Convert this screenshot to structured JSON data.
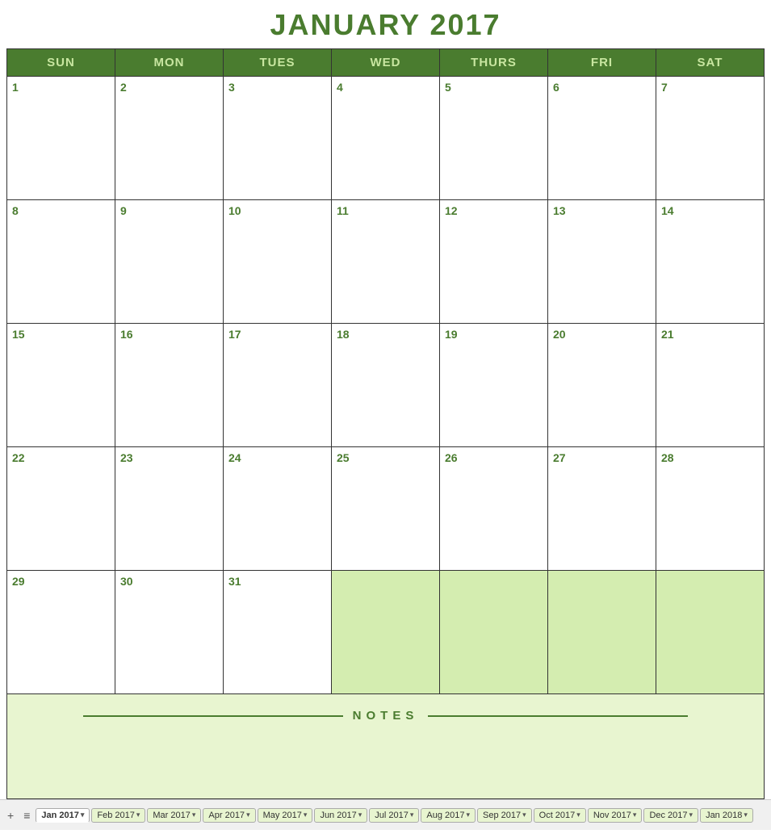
{
  "title": "JANUARY 2017",
  "headers": [
    "SUN",
    "MON",
    "TUES",
    "WED",
    "THURS",
    "FRI",
    "SAT"
  ],
  "weeks": [
    [
      {
        "date": "1",
        "empty": false
      },
      {
        "date": "2",
        "empty": false
      },
      {
        "date": "3",
        "empty": false
      },
      {
        "date": "4",
        "empty": false
      },
      {
        "date": "5",
        "empty": false
      },
      {
        "date": "6",
        "empty": false
      },
      {
        "date": "7",
        "empty": false
      }
    ],
    [
      {
        "date": "8",
        "empty": false
      },
      {
        "date": "9",
        "empty": false
      },
      {
        "date": "10",
        "empty": false
      },
      {
        "date": "11",
        "empty": false
      },
      {
        "date": "12",
        "empty": false
      },
      {
        "date": "13",
        "empty": false
      },
      {
        "date": "14",
        "empty": false
      }
    ],
    [
      {
        "date": "15",
        "empty": false
      },
      {
        "date": "16",
        "empty": false
      },
      {
        "date": "17",
        "empty": false
      },
      {
        "date": "18",
        "empty": false
      },
      {
        "date": "19",
        "empty": false
      },
      {
        "date": "20",
        "empty": false
      },
      {
        "date": "21",
        "empty": false
      }
    ],
    [
      {
        "date": "22",
        "empty": false
      },
      {
        "date": "23",
        "empty": false
      },
      {
        "date": "24",
        "empty": false
      },
      {
        "date": "25",
        "empty": false
      },
      {
        "date": "26",
        "empty": false
      },
      {
        "date": "27",
        "empty": false
      },
      {
        "date": "28",
        "empty": false
      }
    ],
    [
      {
        "date": "29",
        "empty": false
      },
      {
        "date": "30",
        "empty": false
      },
      {
        "date": "31",
        "empty": false
      },
      {
        "date": "",
        "empty": true
      },
      {
        "date": "",
        "empty": true
      },
      {
        "date": "",
        "empty": true
      },
      {
        "date": "",
        "empty": true
      }
    ]
  ],
  "notes_label": "NOTES",
  "tabs": [
    {
      "label": "Jan 2017",
      "active": true
    },
    {
      "label": "Feb 2017",
      "active": false
    },
    {
      "label": "Mar 2017",
      "active": false
    },
    {
      "label": "Apr 2017",
      "active": false
    },
    {
      "label": "May 2017",
      "active": false
    },
    {
      "label": "Jun 2017",
      "active": false
    },
    {
      "label": "Jul 2017",
      "active": false
    },
    {
      "label": "Aug 2017",
      "active": false
    },
    {
      "label": "Sep 2017",
      "active": false
    },
    {
      "label": "Oct 2017",
      "active": false
    },
    {
      "label": "Nov 2017",
      "active": false
    },
    {
      "label": "Dec 2017",
      "active": false
    },
    {
      "label": "Jan 2018",
      "active": false
    }
  ],
  "tab_add_label": "+",
  "tab_menu_label": "≡"
}
